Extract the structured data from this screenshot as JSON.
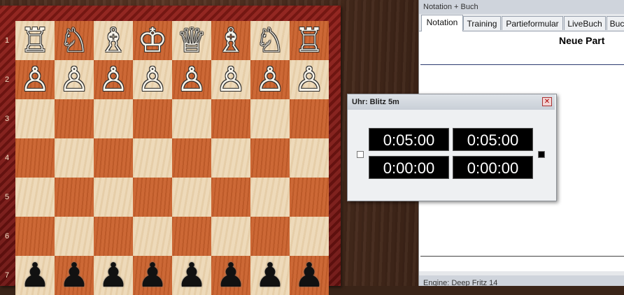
{
  "board": {
    "ranks": [
      "1",
      "2",
      "3",
      "4",
      "5",
      "6",
      "7"
    ],
    "white_back_rank": [
      "♖",
      "♘",
      "♗",
      "♔",
      "♕",
      "♗",
      "♘",
      "♖"
    ],
    "white_pawns": [
      "♙",
      "♙",
      "♙",
      "♙",
      "♙",
      "♙",
      "♙",
      "♙"
    ],
    "black_pawns": [
      "♟",
      "♟",
      "♟",
      "♟",
      "♟",
      "♟",
      "♟",
      "♟"
    ]
  },
  "panel": {
    "title": "Notation + Buch",
    "tabs": [
      "Notation",
      "Training",
      "Partieformular",
      "LiveBuch",
      "Buc"
    ],
    "active_tab": 0,
    "game_title": "Neue Part",
    "engine_label": "Engine: Deep Fritz 14"
  },
  "clock": {
    "title": "Uhr: Blitz 5m",
    "close_glyph": "✕",
    "white_time": "0:05:00",
    "black_time": "0:05:00",
    "white_extra": "0:00:00",
    "black_extra": "0:00:00"
  },
  "colors": {
    "light_square": "#ecd6b2",
    "dark_square": "#c6612f",
    "frame": "#8e1c16"
  }
}
